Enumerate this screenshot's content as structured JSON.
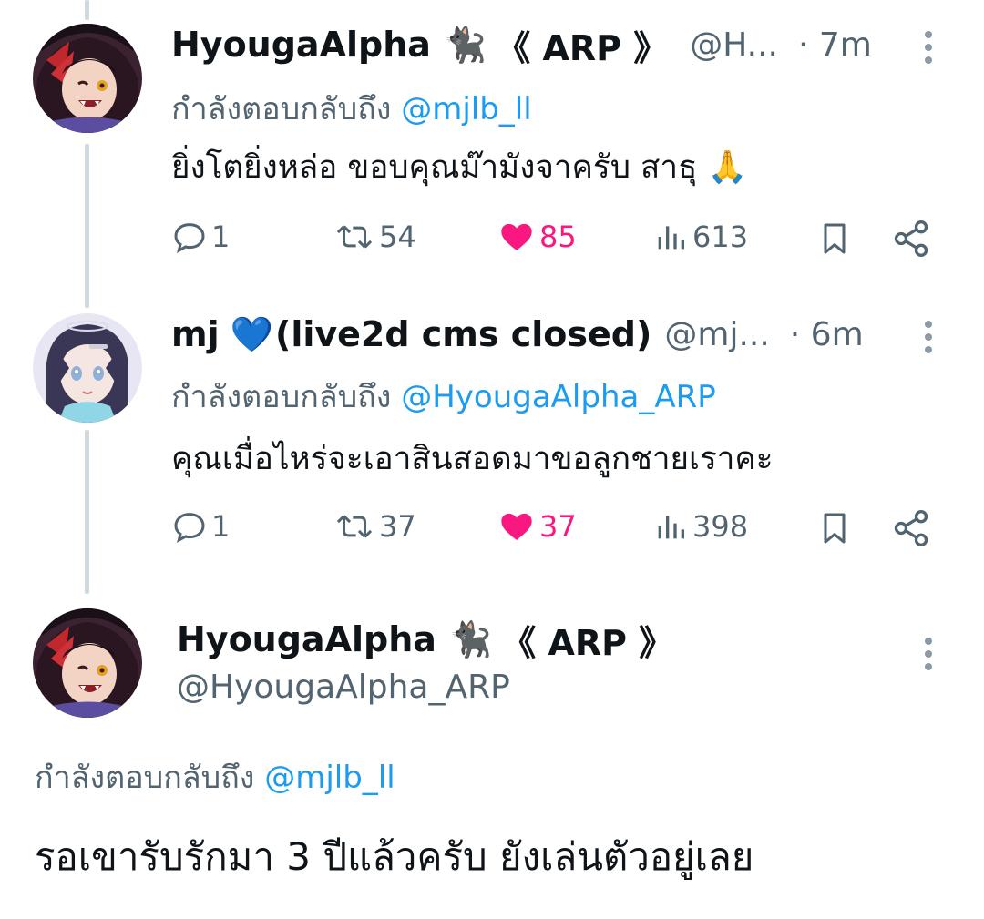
{
  "tweets": [
    {
      "name": "HyougaAlpha",
      "emoji": "🐈‍⬛",
      "tag": "《 ARP 》",
      "handle": "@H...",
      "time": "· 7m",
      "reply_prefix": "กำลังตอบกลับถึง",
      "reply_mention": "@mjlb_ll",
      "text": "ยิ่งโตยิ่งหล่อ ขอบคุณม๊ามังจาครับ สาธุ 🙏",
      "replies": "1",
      "retweets": "54",
      "likes": "85",
      "views": "613"
    },
    {
      "name": "mj",
      "emoji": "💙",
      "tag": "(live2d cms closed)",
      "handle": "@mj...",
      "time": "· 6m",
      "reply_prefix": "กำลังตอบกลับถึง",
      "reply_mention": "@HyougaAlpha_ARP",
      "text": "คุณเมื่อไหร่จะเอาสินสอดมาขอลูกชายเราคะ",
      "replies": "1",
      "retweets": "37",
      "likes": "37",
      "views": "398"
    }
  ],
  "main_tweet": {
    "name": "HyougaAlpha",
    "emoji": "🐈‍⬛",
    "tag": "《 ARP 》",
    "handle": "@HyougaAlpha_ARP",
    "reply_prefix": "กำลังตอบกลับถึง",
    "reply_mention": "@mjlb_ll",
    "text": "รอเขารับรักมา 3 ปีแล้วครับ ยังเล่นตัวอยู่เลย"
  },
  "colors": {
    "text": "#0f1419",
    "secondary": "#536471",
    "accent": "#1d9bf0",
    "like": "#f91880",
    "thread_line": "#cfd9de"
  },
  "icons": [
    "reply-icon",
    "retweet-icon",
    "heart-icon",
    "views-icon",
    "bookmark-icon",
    "share-icon",
    "more-icon"
  ]
}
